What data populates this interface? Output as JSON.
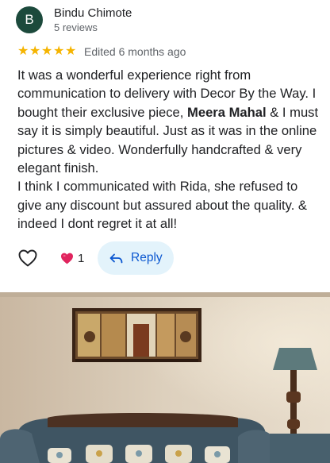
{
  "review": {
    "author": {
      "initial": "B",
      "name": "Bindu Chimote",
      "reviews_count": "5 reviews"
    },
    "rating": 5,
    "star_glyph": "★",
    "edited": "Edited 6 months ago",
    "text": {
      "part1": "It was a wonderful experience right from communication to delivery with Decor By the Way. I bought their exclusive piece, ",
      "highlight": "Meera Mahal",
      "part2": " & I must say it is simply beautiful. Just as it was in the online pictures & video. Wonderfully handcrafted & very elegant finish.",
      "paragraph2": "I think I communicated with Rida, she refused to give any discount but assured about the quality. & indeed I dont regret it at all!"
    },
    "actions": {
      "like_icon": "heart-outline-icon",
      "reaction_icon": "red-heart-icon",
      "reaction_count": "1",
      "reply_icon": "reply-arrow-icon",
      "reply_label": "Reply"
    },
    "colors": {
      "avatar_bg": "#1c4a3c",
      "star": "#f5b400",
      "reply_bg": "#e3f3fb",
      "reply_text": "#0b57d0"
    }
  }
}
